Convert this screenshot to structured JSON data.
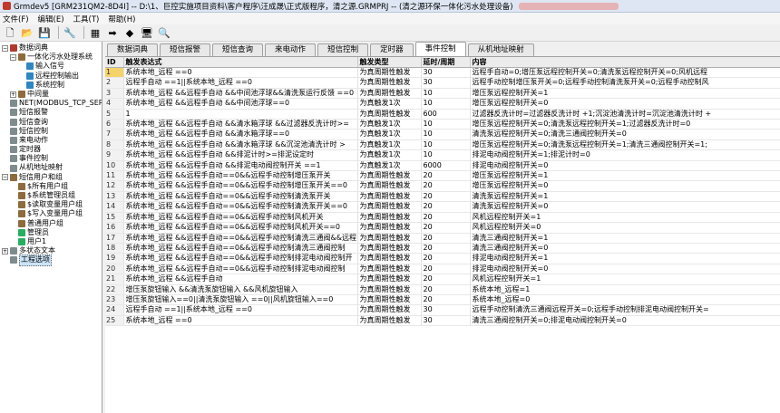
{
  "window": {
    "title": "Grmdev5 [GRM231QM2-8D4I] -- D:\\1、巨控实施项目资料\\客户程序\\汪成晟\\正式版程序，清之源.GRMPRJ -- (清之源环保一体化污水处理设备)"
  },
  "menu": [
    "文件(F)",
    "编辑(E)",
    "工具(T)",
    "帮助(H)"
  ],
  "toolbar": {
    "buttons": [
      {
        "name": "new-icon",
        "glyph": "🗋"
      },
      {
        "name": "open-icon",
        "glyph": "📂"
      },
      {
        "name": "save-icon",
        "glyph": "💾"
      },
      {
        "name": "settings-icon",
        "glyph": "🔧"
      },
      {
        "name": "keypad-icon",
        "glyph": "▦"
      },
      {
        "name": "download-icon",
        "glyph": "➡"
      },
      {
        "name": "upload-icon",
        "glyph": "◆"
      },
      {
        "name": "monitor-icon",
        "glyph": "🖥"
      },
      {
        "name": "search-icon",
        "glyph": "🔍"
      }
    ]
  },
  "tree": [
    {
      "label": "数据词典",
      "level": 0,
      "icon": "ic-db",
      "exp": "−"
    },
    {
      "label": "一体化污水处理系统",
      "level": 1,
      "icon": "ic-grp",
      "exp": "−"
    },
    {
      "label": "输入信号",
      "level": 2,
      "icon": "ic-sig",
      "exp": ""
    },
    {
      "label": "远程控制输出",
      "level": 2,
      "icon": "ic-sig",
      "exp": ""
    },
    {
      "label": "系统控制",
      "level": 2,
      "icon": "ic-sig",
      "exp": ""
    },
    {
      "label": "中间量",
      "level": 1,
      "icon": "ic-grp",
      "exp": "+"
    },
    {
      "label": "NET(MODBUS_TCP_SERVER)",
      "level": 0,
      "icon": "ic-doc",
      "exp": ""
    },
    {
      "label": "短信报警",
      "level": 0,
      "icon": "ic-doc",
      "exp": ""
    },
    {
      "label": "短信查询",
      "level": 0,
      "icon": "ic-doc",
      "exp": ""
    },
    {
      "label": "短信控制",
      "level": 0,
      "icon": "ic-doc",
      "exp": ""
    },
    {
      "label": "来电动作",
      "level": 0,
      "icon": "ic-doc",
      "exp": ""
    },
    {
      "label": "定时器",
      "level": 0,
      "icon": "ic-doc",
      "exp": ""
    },
    {
      "label": "事件控制",
      "level": 0,
      "icon": "ic-doc",
      "exp": ""
    },
    {
      "label": "从机地址映射",
      "level": 0,
      "icon": "ic-doc",
      "exp": ""
    },
    {
      "label": "短信用户和组",
      "level": 0,
      "icon": "ic-grp",
      "exp": "−"
    },
    {
      "label": "$所有用户组",
      "level": 1,
      "icon": "ic-grp",
      "exp": ""
    },
    {
      "label": "$系统管理员组",
      "level": 1,
      "icon": "ic-grp",
      "exp": ""
    },
    {
      "label": "$读取变量用户组",
      "level": 1,
      "icon": "ic-grp",
      "exp": ""
    },
    {
      "label": "$写入变量用户组",
      "level": 1,
      "icon": "ic-grp",
      "exp": ""
    },
    {
      "label": "普通用户组",
      "level": 1,
      "icon": "ic-grp",
      "exp": ""
    },
    {
      "label": "管理员",
      "level": 1,
      "icon": "ic-user",
      "exp": ""
    },
    {
      "label": "用户1",
      "level": 1,
      "icon": "ic-user",
      "exp": ""
    },
    {
      "label": "多状态文本",
      "level": 0,
      "icon": "ic-doc",
      "exp": "+"
    },
    {
      "label": "工程选项",
      "level": 0,
      "icon": "ic-doc",
      "exp": "",
      "selected": true
    }
  ],
  "tabs": [
    "数据词典",
    "短信报警",
    "短信查询",
    "来电动作",
    "短信控制",
    "定时器",
    "事件控制",
    "从机地址映射"
  ],
  "active_tab": 6,
  "table": {
    "headers": [
      "ID",
      "触发表达式",
      "触发类型",
      "延时/周期",
      "内容"
    ],
    "rows": [
      [
        "1",
        "系统本地_远程 ==0",
        "为真周期性触发",
        "30",
        "远程手自动=0;增压泵远程控制开关=0;清洗泵远程控制开关=0;风机远程"
      ],
      [
        "2",
        "远程手自动 ==1||系统本地_远程 ==0",
        "为真周期性触发",
        "30",
        "远程手动控制增压泵开关=0;远程手动控制清洗泵开关=0;远程手动控制风"
      ],
      [
        "3",
        "系统本地_远程 &&远程手自动 &&中间池浮球&&清洗泵运行反馈 ==0",
        "为真周期性触发",
        "10",
        "增压泵远程控制开关=1"
      ],
      [
        "4",
        "系统本地_远程 &&远程手自动 &&中间池浮球==0",
        "为真触发1次",
        "10",
        "增压泵远程控制开关=0"
      ],
      [
        "5",
        "1",
        "为真周期性触发",
        "600",
        "过滤器反洗计时=过滤器反洗计时 +1;沉淀池清洗计时=沉淀池清洗计时 +"
      ],
      [
        "6",
        "系统本地_远程 &&远程手自动 &&清水箱浮球 &&过滤器反洗计时>=",
        "为真触发1次",
        "10",
        "增压泵远程控制开关=0;清洗泵远程控制开关=1;过滤器反洗计时=0"
      ],
      [
        "7",
        "系统本地_远程 &&远程手自动 &&清水箱浮球==0",
        "为真触发1次",
        "10",
        "清洗泵远程控制开关=0;清洗三通阀控制开关=0"
      ],
      [
        "8",
        "系统本地_远程 &&远程手自动 &&清水箱浮球 &&沉淀池清洗计时 >",
        "为真触发1次",
        "10",
        "增压泵远程控制开关=0;清洗泵远程控制开关=1;清洗三通阀控制开关=1;"
      ],
      [
        "9",
        "系统本地_远程 &&远程手自动 &&排泥计时>=排泥设定时",
        "为真触发1次",
        "10",
        "排泥电动阀控制开关=1;排泥计时=0"
      ],
      [
        "10",
        "系统本地_远程 &&远程手自动 &&排泥电动阀控制开关 ==1",
        "为真触发1次",
        "6000",
        "排泥电动阀控制开关=0"
      ],
      [
        "11",
        "系统本地_远程 &&远程手自动==0&&远程手动控制增压泵开关",
        "为真周期性触发",
        "20",
        "增压泵远程控制开关=1"
      ],
      [
        "12",
        "系统本地_远程 &&远程手自动==0&&远程手动控制增压泵开关==0",
        "为真周期性触发",
        "20",
        "增压泵远程控制开关=0"
      ],
      [
        "13",
        "系统本地_远程 &&远程手自动==0&&远程手动控制清洗泵开关",
        "为真周期性触发",
        "20",
        "清洗泵远程控制开关=1"
      ],
      [
        "14",
        "系统本地_远程 &&远程手自动==0&&远程手动控制清洗泵开关==0",
        "为真周期性触发",
        "20",
        "清洗泵远程控制开关=0"
      ],
      [
        "15",
        "系统本地_远程 &&远程手自动==0&&远程手动控制风机开关",
        "为真周期性触发",
        "20",
        "风机远程控制开关=1"
      ],
      [
        "16",
        "系统本地_远程 &&远程手自动==0&&远程手动控制风机开关==0",
        "为真周期性触发",
        "20",
        "风机远程控制开关=0"
      ],
      [
        "17",
        "系统本地_远程 &&远程手自动==0&&远程手动控制清洗三通阀&&远程",
        "为真周期性触发",
        "20",
        "清洗三通阀控制开关=1"
      ],
      [
        "18",
        "系统本地_远程 &&远程手自动==0&&远程手动控制清洗三通阀控制",
        "为真周期性触发",
        "20",
        "清洗三通阀控制开关=0"
      ],
      [
        "19",
        "系统本地_远程 &&远程手自动==0&&远程手动控制排泥电动阀控制开",
        "为真周期性触发",
        "20",
        "排泥电动阀控制开关=1"
      ],
      [
        "20",
        "系统本地_远程 &&远程手自动==0&&远程手动控制排泥电动阀控制",
        "为真周期性触发",
        "20",
        "排泥电动阀控制开关=0"
      ],
      [
        "21",
        "系统本地_远程 &&远程手自动",
        "为真周期性触发",
        "20",
        "风机远程控制开关=1"
      ],
      [
        "22",
        "增压泵旋钮输入 &&清洗泵旋钮输入 &&风机旋钮输入",
        "为真周期性触发",
        "20",
        "系统本地_远程=1"
      ],
      [
        "23",
        "增压泵旋钮输入==0||清洗泵旋钮输入 ==0||风机旋钮输入==0",
        "为真周期性触发",
        "20",
        "系统本地_远程=0"
      ],
      [
        "24",
        "远程手自动 ==1||系统本地_远程 ==0",
        "为真周期性触发",
        "30",
        "远程手动控制清洗三通阀远程开关=0;远程手动控制排泥电动阀控制开关="
      ],
      [
        "25",
        "系统本地_远程 ==0",
        "为真周期性触发",
        "30",
        "清洗三通阀控制开关=0;排泥电动阀控制开关=0"
      ]
    ]
  }
}
